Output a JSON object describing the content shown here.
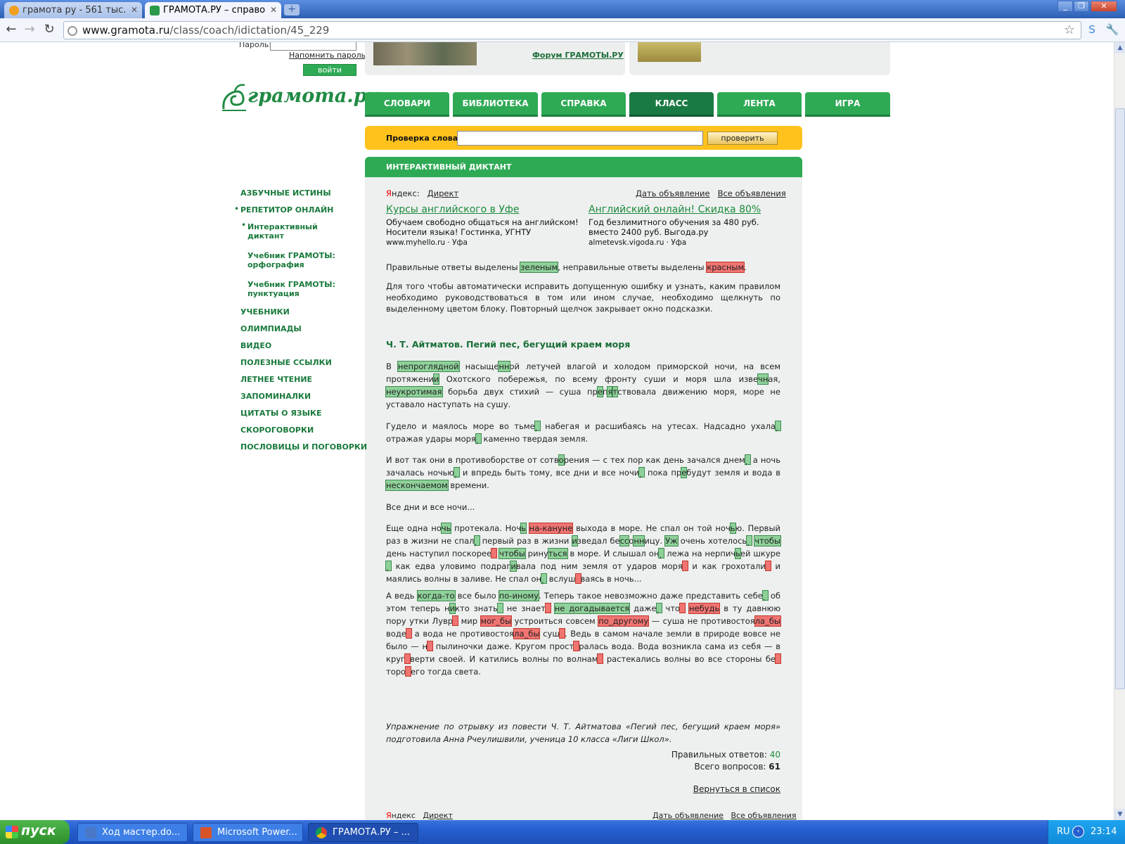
{
  "browser": {
    "tabs": [
      {
        "title": "грамота ру - 561 тыс.",
        "active": false
      },
      {
        "title": "ГРАМОТА.РУ – справо",
        "active": true
      }
    ],
    "new_tab": "+",
    "window_buttons": [
      "_",
      "❐",
      "✕"
    ],
    "url_domain": "www.gramota.ru",
    "url_path": "/class/coach/idictation/45_229",
    "back_icon": "←",
    "forward_icon": "→",
    "reload_icon": "↻"
  },
  "header": {
    "password_label": "Пароль:",
    "remind_link": "Напомнить пароль",
    "enter_button": "войти",
    "forum_link": "Форум ГРАМОТЫ.РУ",
    "logo_text": "грамота.ру"
  },
  "main_nav": [
    {
      "label": "СЛОВАРИ",
      "active": false
    },
    {
      "label": "БИБЛИОТЕКА",
      "active": false
    },
    {
      "label": "СПРАВКА",
      "active": false
    },
    {
      "label": "КЛАСС",
      "active": true
    },
    {
      "label": "ЛЕНТА",
      "active": false
    },
    {
      "label": "ИГРА",
      "active": false
    }
  ],
  "word_check": {
    "label": "Проверка слова:",
    "value": "",
    "button": "проверить"
  },
  "section_title": "ИНТЕРАКТИВНЫЙ ДИКТАНТ",
  "sidebar": [
    {
      "label": "АЗБУЧНЫЕ ИСТИНЫ"
    },
    {
      "label": "РЕПЕТИТОР ОНЛАЙН"
    },
    {
      "label": "Интерактивный диктант"
    },
    {
      "label": "Учебник ГРАМОТЫ: орфография"
    },
    {
      "label": "Учебник ГРАМОТЫ: пунктуация"
    },
    {
      "label": "УЧЕБНИКИ"
    },
    {
      "label": "ОЛИМПИАДЫ"
    },
    {
      "label": "ВИДЕО"
    },
    {
      "label": "ПОЛЕЗНЫЕ ССЫЛКИ"
    },
    {
      "label": "ЛЕТНЕЕ ЧТЕНИЕ"
    },
    {
      "label": "ЗАПОМИНАЛКИ"
    },
    {
      "label": "ЦИТАТЫ О ЯЗЫКЕ"
    },
    {
      "label": "СКОРОГОВОРКИ"
    },
    {
      "label": "ПОСЛОВИЦЫ И ПОГОВОРКИ"
    }
  ],
  "ads": {
    "yandex_first": "Я",
    "yandex_rest": "ндекс",
    "direct": "Директ",
    "post_ad": "Дать объявление",
    "all_ads": "Все объявления",
    "items": [
      {
        "title": "Курсы английского в Уфе",
        "body": "Обучаем свободно общаться на английском! Носители языка! Гостинка, УГНТУ",
        "url": "www.myhello.ru",
        "city": "Уфа"
      },
      {
        "title": "Английский онлайн! Скидка 80%",
        "body": "Год безлимитного обучения за 480 руб. вместо 2400 руб. Выгода.ру",
        "url": "almetevsk.vigoda.ru",
        "city": "Уфа"
      }
    ]
  },
  "legend": {
    "before": "Правильные ответы выделены ",
    "green_word": "зеленым",
    "middle": ", неправильные ответы выделены ",
    "red_word": "красным",
    "after": "."
  },
  "instructions": "Для того чтобы автоматически исправить допущенную ошибку и узнать, каким правилом необходимо руководствоваться в том или ином случае, необходимо щелкнуть по выделенному цветом блоку. Повторный щелчок закрывает окно подсказки.",
  "dictation_title": "Ч. Т. Айтматов. Пегий пес, бегущий краем моря",
  "dictation_heading": "Все дни и все ночи...",
  "credit": "Упражнение по отрывку из повести Ч. Т. Айтматова «Пегий пес, бегущий краем моря» подготовила Анна Рчеулишвили, ученица 10 класса «Лиги Школ».",
  "results": {
    "correct_label": "Правильных ответов:",
    "correct_value": "40",
    "total_label": "Всего вопросов:",
    "total_value": "61",
    "back_link": "Вернуться в список"
  },
  "taskbar": {
    "start": "пуск",
    "tasks": [
      {
        "title": "Ход мастер.do...",
        "color": "#4a78c8"
      },
      {
        "title": "Microsoft Power...",
        "color": "#d9532a"
      },
      {
        "title": "ГРАМОТА.РУ – ...",
        "color": "#e9b53a"
      }
    ],
    "language": "RU",
    "clock": "23:14"
  }
}
